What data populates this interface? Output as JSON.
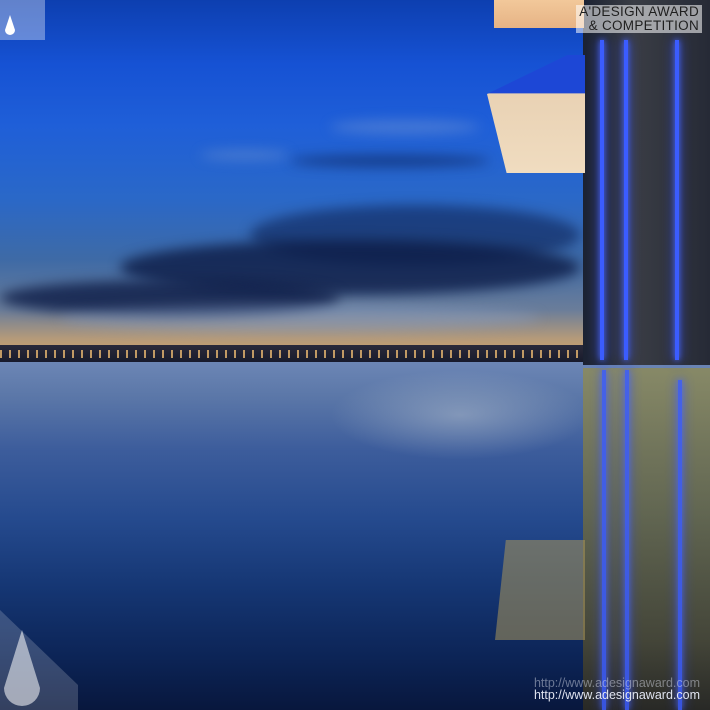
{
  "watermark": {
    "brand_line1": "A'DESIGN AWARD",
    "brand_line2": "& COMPETITION",
    "url_top": "http://www.adesignaward.com",
    "url_bottom": "http://www.adesignaward.com"
  },
  "scene": {
    "sky_color": "#1652d4",
    "light_strip_color": "#3b5cff",
    "canopy_color": "#f0dcc0",
    "water_color": "#254a8e"
  }
}
